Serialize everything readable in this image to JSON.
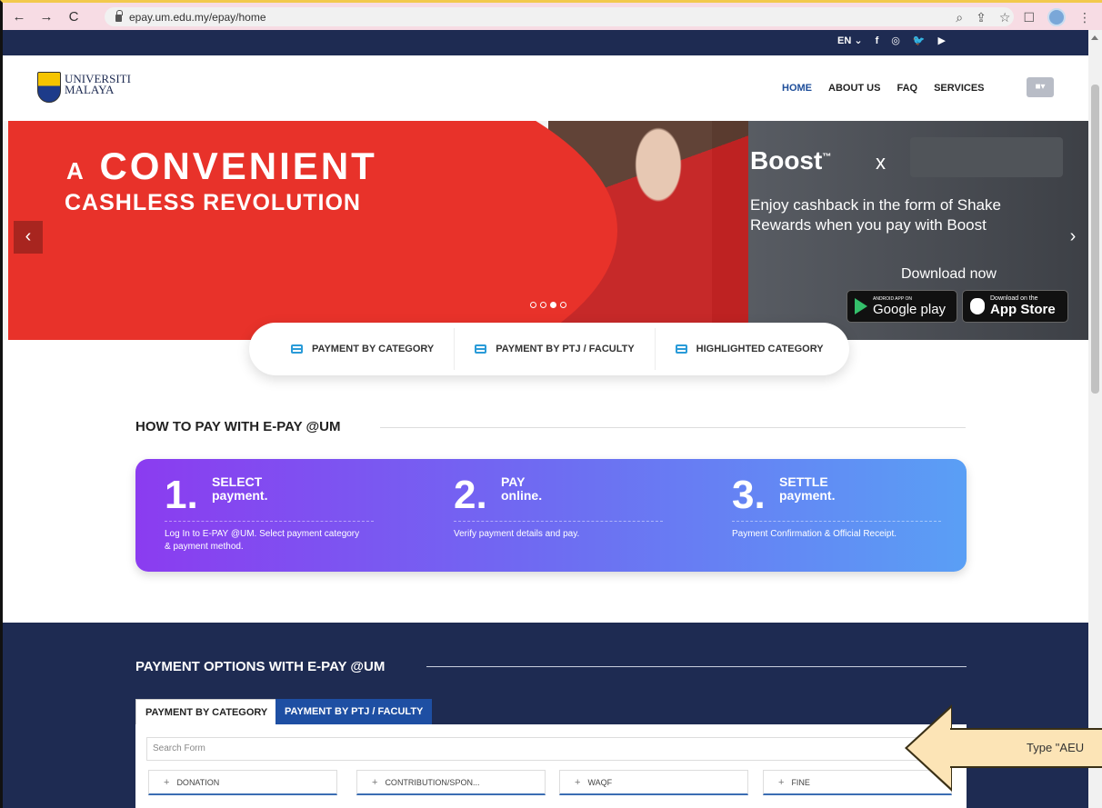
{
  "browser": {
    "url": "epay.um.edu.my/epay/home",
    "nav_back": "←",
    "nav_forward": "→",
    "nav_reload": "C",
    "icons": [
      "search-icon",
      "share-icon",
      "star-icon",
      "sidepanel-icon",
      "profile-avatar",
      "more-icon"
    ]
  },
  "topbar": {
    "lang": "EN ⌄",
    "social": [
      "f",
      "◎",
      "🐦",
      "▶"
    ]
  },
  "header": {
    "logo_line1": "UNIVERSITI",
    "logo_line2": "MALAYA",
    "menu": [
      "HOME",
      "ABOUT US",
      "FAQ",
      "SERVICES"
    ],
    "user_icon": "▾"
  },
  "banner": {
    "headline_small": "A",
    "headline_big": "CONVENIENT",
    "headline2": "CASHLESS REVOLUTION",
    "boost": "Boost",
    "boost_tm": "™",
    "boost_x": "x",
    "boost_text": "Enjoy cashback in the form of Shake Rewards when you pay with Boost",
    "download": "Download now",
    "google_small": "ANDROID APP ON",
    "google": "Google play",
    "apple_small": "Download on the",
    "apple": "App Store",
    "prev": "‹",
    "next": "›",
    "slide_count": 4,
    "active_slide": 3
  },
  "category_bar": [
    "PAYMENT BY CATEGORY",
    "PAYMENT BY PTJ / FACULTY",
    "HIGHLIGHTED CATEGORY"
  ],
  "how_to_pay": {
    "title": "HOW TO PAY WITH E-PAY @UM",
    "steps": [
      {
        "num": "1.",
        "line1": "SELECT",
        "line2": "payment.",
        "desc": "Log In to E-PAY @UM. Select payment category & payment method."
      },
      {
        "num": "2.",
        "line1": "PAY",
        "line2": "online.",
        "desc": "Verify payment details and pay."
      },
      {
        "num": "3.",
        "line1": "SETTLE",
        "line2": "payment.",
        "desc": "Payment Confirmation & Official Receipt."
      }
    ]
  },
  "payment_options": {
    "title": "PAYMENT OPTIONS WITH E-PAY @UM",
    "tabs": [
      "PAYMENT BY CATEGORY",
      "PAYMENT BY PTJ / FACULTY"
    ],
    "search_placeholder": "Search Form",
    "categories": [
      "DONATION",
      "CONTRIBUTION/SPON...",
      "WAQF",
      "FINE"
    ]
  },
  "callout": {
    "text": "Type \"AEU"
  },
  "colors": {
    "navy": "#1e2b52",
    "red": "#e8322a",
    "accent_blue": "#2a9bd8",
    "gradient_start": "#8b3cf0",
    "gradient_end": "#5a9ff5"
  }
}
